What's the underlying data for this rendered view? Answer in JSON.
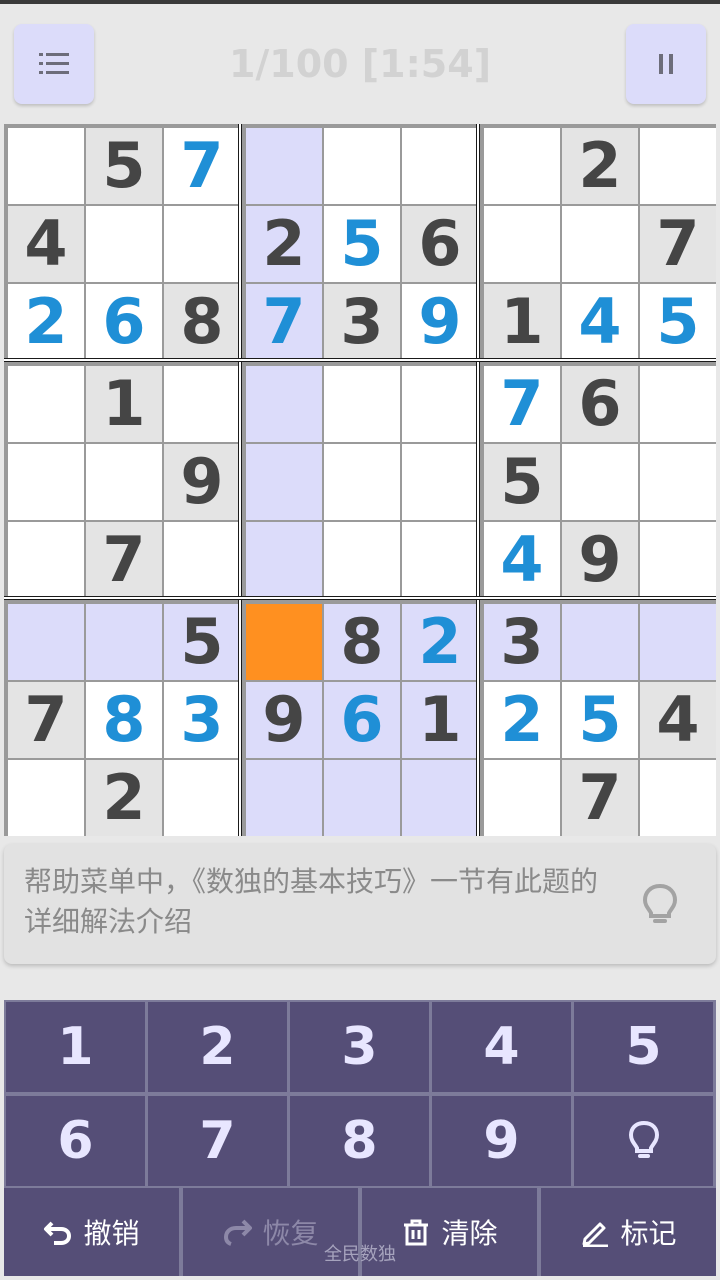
{
  "header": {
    "title": "1/100 [1:54]",
    "menu_icon": "list-icon",
    "pause_icon": "pause-icon"
  },
  "board": {
    "rows": [
      [
        {
          "v": "",
          "t": "w"
        },
        {
          "v": "5",
          "t": "g"
        },
        {
          "v": "7",
          "t": "u"
        },
        {
          "v": "",
          "t": "h"
        },
        {
          "v": "",
          "t": "w"
        },
        {
          "v": "",
          "t": "w"
        },
        {
          "v": "",
          "t": "w"
        },
        {
          "v": "2",
          "t": "g"
        },
        {
          "v": "",
          "t": "w"
        }
      ],
      [
        {
          "v": "4",
          "t": "g"
        },
        {
          "v": "",
          "t": "w"
        },
        {
          "v": "",
          "t": "w"
        },
        {
          "v": "2",
          "t": "hg"
        },
        {
          "v": "5",
          "t": "u"
        },
        {
          "v": "6",
          "t": "g"
        },
        {
          "v": "",
          "t": "w"
        },
        {
          "v": "",
          "t": "w"
        },
        {
          "v": "7",
          "t": "g"
        }
      ],
      [
        {
          "v": "2",
          "t": "u"
        },
        {
          "v": "6",
          "t": "u"
        },
        {
          "v": "8",
          "t": "g"
        },
        {
          "v": "7",
          "t": "hu"
        },
        {
          "v": "3",
          "t": "g"
        },
        {
          "v": "9",
          "t": "u"
        },
        {
          "v": "1",
          "t": "g"
        },
        {
          "v": "4",
          "t": "u"
        },
        {
          "v": "5",
          "t": "u"
        }
      ],
      [
        {
          "v": "",
          "t": "w"
        },
        {
          "v": "1",
          "t": "g"
        },
        {
          "v": "",
          "t": "w"
        },
        {
          "v": "",
          "t": "h"
        },
        {
          "v": "",
          "t": "w"
        },
        {
          "v": "",
          "t": "w"
        },
        {
          "v": "7",
          "t": "u"
        },
        {
          "v": "6",
          "t": "g"
        },
        {
          "v": "",
          "t": "w"
        }
      ],
      [
        {
          "v": "",
          "t": "w"
        },
        {
          "v": "",
          "t": "w"
        },
        {
          "v": "9",
          "t": "g"
        },
        {
          "v": "",
          "t": "h"
        },
        {
          "v": "",
          "t": "w"
        },
        {
          "v": "",
          "t": "w"
        },
        {
          "v": "5",
          "t": "g"
        },
        {
          "v": "",
          "t": "w"
        },
        {
          "v": "",
          "t": "w"
        }
      ],
      [
        {
          "v": "",
          "t": "w"
        },
        {
          "v": "7",
          "t": "g"
        },
        {
          "v": "",
          "t": "w"
        },
        {
          "v": "",
          "t": "h"
        },
        {
          "v": "",
          "t": "w"
        },
        {
          "v": "",
          "t": "w"
        },
        {
          "v": "4",
          "t": "u"
        },
        {
          "v": "9",
          "t": "g"
        },
        {
          "v": "",
          "t": "w"
        }
      ],
      [
        {
          "v": "",
          "t": "h"
        },
        {
          "v": "",
          "t": "h"
        },
        {
          "v": "5",
          "t": "hg"
        },
        {
          "v": "",
          "t": "sel"
        },
        {
          "v": "8",
          "t": "hg"
        },
        {
          "v": "2",
          "t": "hu"
        },
        {
          "v": "3",
          "t": "hg"
        },
        {
          "v": "",
          "t": "h"
        },
        {
          "v": "",
          "t": "h"
        }
      ],
      [
        {
          "v": "7",
          "t": "g"
        },
        {
          "v": "8",
          "t": "u"
        },
        {
          "v": "3",
          "t": "u"
        },
        {
          "v": "9",
          "t": "hg"
        },
        {
          "v": "6",
          "t": "hu"
        },
        {
          "v": "1",
          "t": "hg"
        },
        {
          "v": "2",
          "t": "u"
        },
        {
          "v": "5",
          "t": "u"
        },
        {
          "v": "4",
          "t": "g"
        }
      ],
      [
        {
          "v": "",
          "t": "w"
        },
        {
          "v": "2",
          "t": "g"
        },
        {
          "v": "",
          "t": "w"
        },
        {
          "v": "",
          "t": "h"
        },
        {
          "v": "",
          "t": "h"
        },
        {
          "v": "",
          "t": "h"
        },
        {
          "v": "",
          "t": "w"
        },
        {
          "v": "7",
          "t": "g"
        },
        {
          "v": "",
          "t": "w"
        }
      ]
    ]
  },
  "hint": {
    "text": "帮助菜单中，《数独的基本技巧》一节有此题的详细解法介绍",
    "icon": "lightbulb-icon"
  },
  "keypad": {
    "numbers": [
      "1",
      "2",
      "3",
      "4",
      "5",
      "6",
      "7",
      "8",
      "9"
    ],
    "hint_icon": "lightbulb-icon"
  },
  "actions": {
    "undo": "撤销",
    "redo": "恢复",
    "clear": "清除",
    "mark": "标记"
  },
  "watermark": "全民数独",
  "colors": {
    "given": "#454545",
    "user": "#1f8fd6",
    "highlight": "#dcdcfa",
    "selected": "#ff9020",
    "keypad": "#554e77"
  }
}
